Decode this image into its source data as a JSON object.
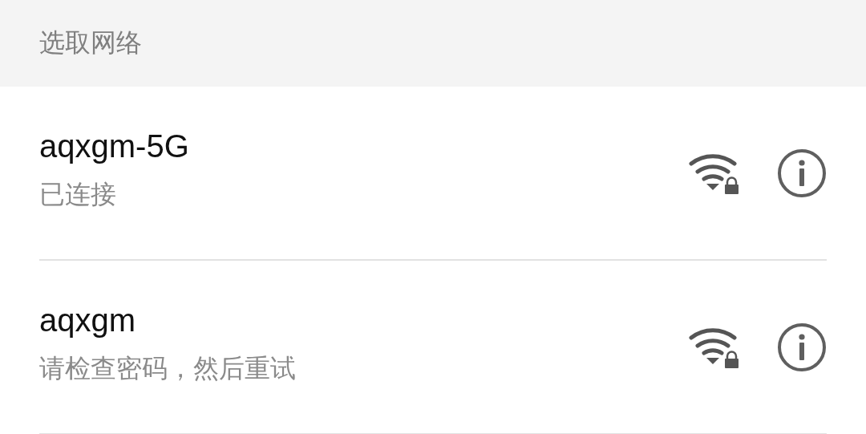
{
  "header": {
    "title": "选取网络"
  },
  "networks": [
    {
      "name": "aqxgm-5G",
      "status": "已连接",
      "secured": true
    },
    {
      "name": "aqxgm",
      "status": "请检查密码，然后重试",
      "secured": true
    }
  ]
}
